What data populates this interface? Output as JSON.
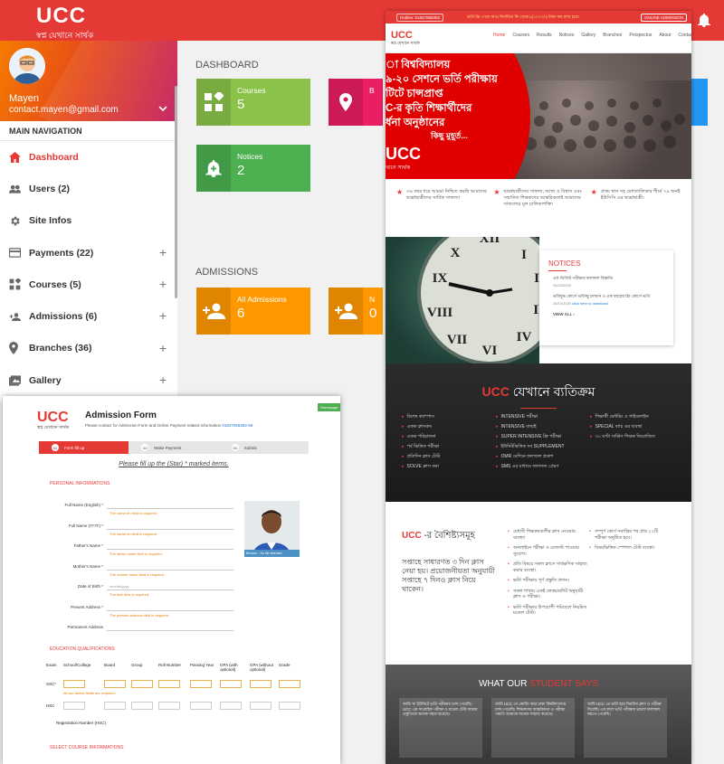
{
  "header": {
    "logo_text": "UCC",
    "logo_tagline": "স্বপ্ন যেখানে সার্থক"
  },
  "profile": {
    "name": "Mayen",
    "email": "contact.mayen@gmail.com"
  },
  "sidebar": {
    "nav_heading": "MAIN NAVIGATION",
    "items": [
      {
        "label": "Dashboard",
        "icon": "home-icon",
        "active": true,
        "expand": ""
      },
      {
        "label": "Users (2)",
        "icon": "users-icon",
        "active": false,
        "expand": ""
      },
      {
        "label": "Site Infos",
        "icon": "gear-icon",
        "active": false,
        "expand": ""
      },
      {
        "label": "Payments (22)",
        "icon": "credit-card-icon",
        "active": false,
        "expand": "+"
      },
      {
        "label": "Courses (5)",
        "icon": "widgets-icon",
        "active": false,
        "expand": "+"
      },
      {
        "label": "Admissions (6)",
        "icon": "person-add-icon",
        "active": false,
        "expand": "+"
      },
      {
        "label": "Branches (36)",
        "icon": "location-pin-icon",
        "active": false,
        "expand": "+"
      },
      {
        "label": "Gallery",
        "icon": "image-icon",
        "active": false,
        "expand": "+"
      }
    ]
  },
  "dashboard": {
    "title": "DASHBOARD",
    "cards": [
      {
        "label": "Courses",
        "value": "5",
        "color": "#8bc34a"
      },
      {
        "label": "B",
        "value": "",
        "color": "#e91e63"
      },
      {
        "label": "Notices",
        "value": "2",
        "color": "#4caf50"
      }
    ],
    "admissions_title": "ADMISSIONS",
    "admission_cards": [
      {
        "label": "All Admissions",
        "value": "6",
        "color": "#ff9800"
      },
      {
        "label": "N",
        "value": "0",
        "color": "#ff9800"
      }
    ]
  },
  "website": {
    "topbar": {
      "hotline": "Hotline: 01847066362",
      "marquee": "ভর্তি ফ্রি পেয়ে নাও! নির্ধারিত ফি থেকে ৳(১০০০/-) টাকা কম রাখা হবে।",
      "online_btn": "ONLINE ADMISSION"
    },
    "logo": {
      "text": "UCC",
      "tagline": "স্বপ্ন যেখানে সার্থক"
    },
    "menu": [
      "Home",
      "Courses",
      "Results",
      "Notices",
      "Gallery",
      "Branches",
      "Prospectus",
      "About",
      "Contact"
    ],
    "hero": {
      "lines": [
        "া বিশ্ববিদ্যালয়",
        "৯-২০ সেশনে ভর্তি পরীক্ষায়",
        "টিটে চান্সপ্রাপ্ত",
        "C-র কৃতি শিক্ষার্থীদের",
        "র্ধনা অনুষ্ঠানের",
        "কিছু মুহূর্ত..."
      ],
      "logo": "UCC",
      "sub": "খানে সার্থক"
    },
    "features": [
      "৩৬ বছর ধরে আমরা নিশ্চিত করছি আমাদের ছাত্র/ছাত্রীদের সার্বিক সাফল্য।",
      "ছাত্র/ছাত্রীদের সাফল্য, আস্থা ও বিশ্বাস এবং সম্মানিত শিক্ষকদের আন্তরিকতাই আমাদের সাফল্যের মূল চালিকাশক্তি।",
      "প্রথম স্থান সহ মেধাতালিকার শীর্ষে ৭৯ জনই ইউসিসি এর ছাত্র/ছাত্রী।"
    ],
    "notices": {
      "title": "NOTICES",
      "items": [
        {
          "text": "এক ডিজিট পরীক্ষার ফলাফল বিজ্ঞপ্তি",
          "date": "26/10/2020",
          "link": ""
        },
        {
          "text": "ভর্তিযুদ্ধ কোর্সে ভর্তিচ্ছু চলমান ও এক বছরের ফ্রি কোর্সে ভর্তি",
          "date": "26/10/2020",
          "link": "click here to download"
        }
      ],
      "view_all": "VIEW ALL ›"
    },
    "why": {
      "title_brand": "UCC",
      "title_rest": "যেখানে ব্যতিক্রম",
      "cols": [
        [
          "বিশেষ ক্যাম্পাস",
          "একক ক্লাসরুম",
          "একক পরিচালনা",
          "পর্ব ভিত্তিক পরীক্ষা",
          "প্রতিদিন ক্লাস টেস্ট",
          "SOLVE ক্লাস করা"
        ],
        [
          "INTENSIVE পরীক্ষা",
          "INTENSIVE বাছাই",
          "SUPER INTENSIVE ফ্রি পরীক্ষা",
          "ইউনিটভিত্তিক সব SUPPLEMENT",
          "OMR মেশিনে ফলাফল প্রকাশ",
          "SMS এর মাধ্যমে ফলাফল প্রেরণ"
        ],
        [
          "শিক্ষার্থী মেন্টরিং ও গাইডলাইন",
          "SPECIAL ব্যাচ এর ব্যবস্থা",
          "৩০ ঘণ্টা সার্ভিস শিক্ষক নিয়োজিত"
        ]
      ]
    },
    "features2": {
      "title_brand": "UCC",
      "title_rest": "-র বৈশিষ্ট্যসমূহ",
      "intro": "সপ্তাহে সাধারণত ৩ দিন ক্লাস নেয়া হয়। প্রয়োজনীয়তা অনুযায়ী সপ্তাহে ৭ দিনও ক্লাস নিয়ে থাকেন।",
      "col2": [
        "মেধাবী শিক্ষকমণ্ডলীর ক্লাস নেওয়ার ব্যবস্থা।",
        "অনলাইনে পরীক্ষা ও রেজাল্ট পাওয়ার সুযোগ।",
        "প্রতি বিষয়ে সকল ক্লাসে সার্বক্ষণিক সাহায্য করার ব্যবস্থা।",
        "ভর্তি পরীক্ষায় পূর্ণ প্রস্তুতি প্রদান।",
        "সকল শাখায় একই লেকচারশিট অনুযায়ী ক্লাস ও পরীক্ষা।",
        "ভর্তি পরীক্ষার উপযোগী পরিবেশে নিয়মিত মডেল টেস্ট।"
      ],
      "col3": [
        "সম্পূর্ণ কোর্স সমাপ্তির পর প্রায় ২১টি পরীক্ষা অনুষ্ঠিত হবে।",
        "বিষয়ভিত্তিক স্পেশাল টেস্ট ব্যবস্থা।"
      ]
    },
    "testimonials": {
      "title_a": "WHAT OUR",
      "title_b": "STUDENT SAYS",
      "items": [
        "আমি 'ক' ইউনিটে ভর্তি পরীক্ষায় চান্স পেয়েছি। UCC এর সাপ্তাহিক পরীক্ষা ও মডেল টেস্ট আমার প্রস্তুতিকে অনেক সহজ করেছে।",
        "আমি UCC তে কোচিং করে ঢাকা বিশ্ববিদ্যালয়ে চান্স পেয়েছি। শিক্ষকদের আন্তরিকতা ও পরীক্ষা পদ্ধতি আমাকে অনেক সাহায্য করেছে।",
        "আমি UCC তে ভর্তি হয়ে নিয়মিত ক্লাস ও পরীক্ষা দিয়েছি। এর ফলে ভর্তি পরীক্ষায় ভালো ফলাফল করতে পেরেছি।"
      ]
    }
  },
  "admission_form": {
    "homepage_btn": "Homepage",
    "logo": "UCC",
    "tagline": "স্বপ্ন যেখানে সার্থক",
    "title": "Admission Form",
    "subtitle": "Please contact for Admission Form and Online Payment related information",
    "phone": "01847066362-66",
    "steps": [
      {
        "num": "01",
        "label": "Form fill up",
        "active": true
      },
      {
        "num": "02",
        "label": "Make Payment",
        "active": false
      },
      {
        "num": "03",
        "label": "Submit",
        "active": false
      }
    ],
    "fill_note": "Please fill up the (Star) * marked items.",
    "personal_heading": "PERSONAL INFORMATIONS",
    "fields": [
      {
        "label": "Full Name (English) *",
        "error": "The name en field is required."
      },
      {
        "label": "Full Name (বাংলা) *",
        "error": "The name bn field is required."
      },
      {
        "label": "Father's Name *",
        "error": "The father name field is required."
      },
      {
        "label": "Mother's Name *",
        "error": "The mother name field is required."
      },
      {
        "label": "Date of Birth *",
        "error": "The dob field is required.",
        "placeholder": "mm/dd/yyyy"
      },
      {
        "label": "Present Address *",
        "error": "The present address field is required."
      },
      {
        "label": "Parmanent Address",
        "error": ""
      }
    ],
    "photo_bar": "Browse...    No file selected",
    "edu_heading": "EDUCATION QUALIFICATIONS",
    "edu_cols": [
      "Exam",
      "School/College",
      "Board",
      "Group",
      "Roll Number",
      "Passing Year",
      "GPA (with optional)",
      "GPA (without optional)",
      "Grade"
    ],
    "edu_rows": [
      {
        "exam": "SSC*",
        "error": "All ssc above fields are required."
      },
      {
        "exam": "HSC",
        "error": ""
      }
    ],
    "reg_label": "Registration Number (HSC)",
    "course_heading": "SELECT COURSE INFORMATIONS"
  }
}
